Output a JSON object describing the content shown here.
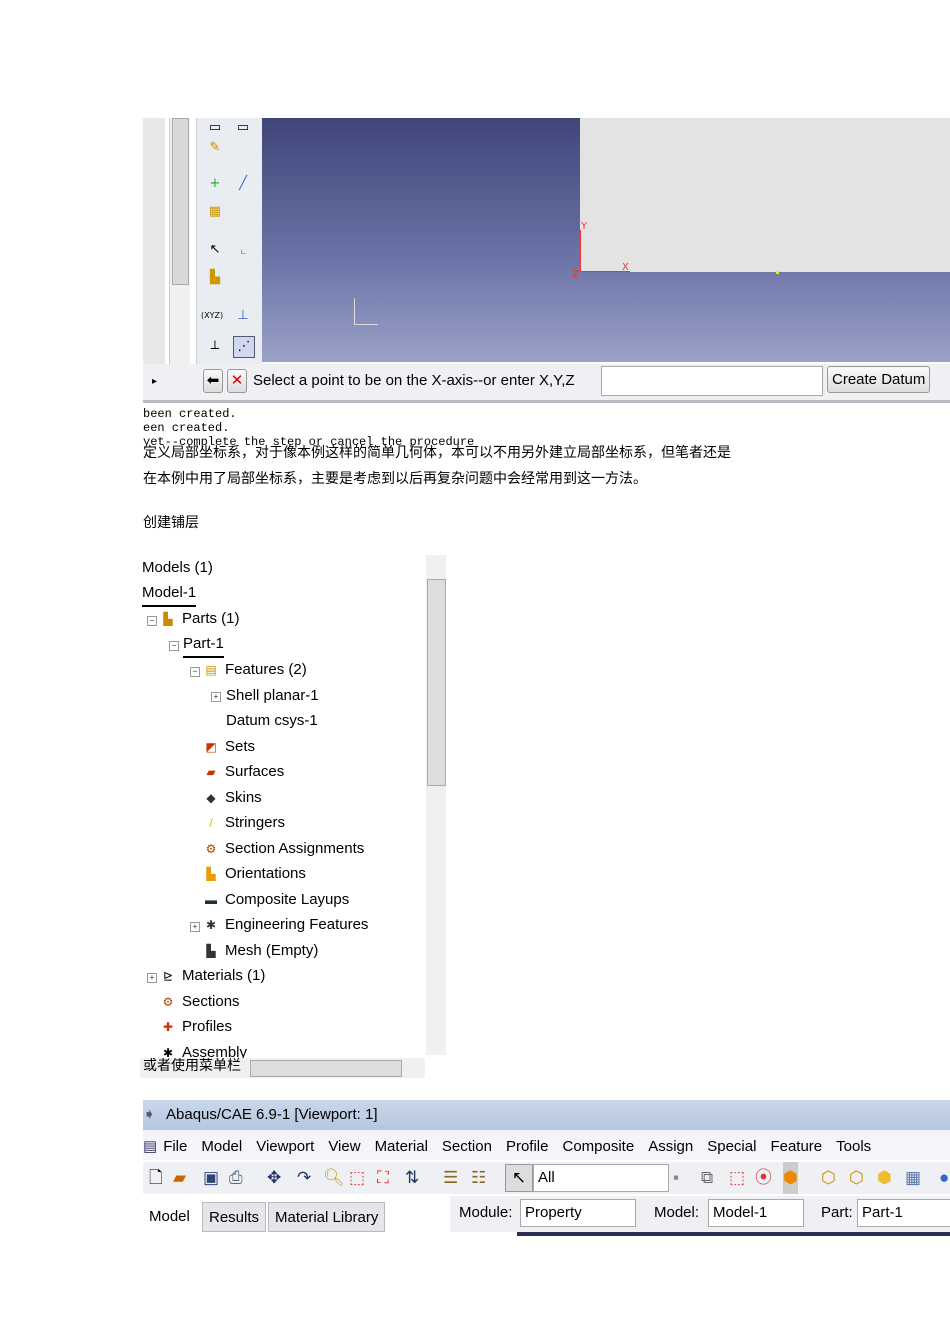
{
  "viewport": {
    "axis_y": "Y",
    "axis_x": "X",
    "axis_z": "Z"
  },
  "prompt": {
    "text": "Select a point to be on the X-axis--or enter X,Y,Z",
    "input_value": "",
    "create_button": "Create Datum"
  },
  "messages": [
    "been created.",
    "een created.",
    "yet--complete the step or cancel the procedure"
  ],
  "paragraph": [
    "定义局部坐标系，对于像本例这样的简单几何体，本可以不用另外建立局部坐标系，但笔者还是",
    "在本例中用了局部坐标系，主要是考虑到以后再复杂问题中会经常用到这一方法。"
  ],
  "heading1": "创建铺层",
  "tree": [
    "Models (1)",
    "Model-1",
    "Parts (1)",
    "Part-1",
    "Features (2)",
    "Shell planar-1",
    "Datum csys-1",
    "Sets",
    "Surfaces",
    "Skins",
    "Stringers",
    "Section Assignments",
    "Orientations",
    "Composite Layups",
    "Engineering Features",
    "Mesh (Empty)",
    "Materials (1)",
    "Sections",
    "Profiles",
    "Assembly"
  ],
  "heading2": "或者使用菜单栏",
  "app": {
    "title": "Abaqus/CAE 6.9-1 [Viewport: 1]",
    "menu": [
      "File",
      "Model",
      "Viewport",
      "View",
      "Material",
      "Section",
      "Profile",
      "Composite",
      "Assign",
      "Special",
      "Feature",
      "Tools"
    ],
    "selection_filter": "All",
    "tabs": [
      "Model",
      "Results",
      "Material Library"
    ],
    "module_label": "Module:",
    "module": "Property",
    "model_label": "Model:",
    "model": "Model-1",
    "part_label": "Part:",
    "part": "Part-1"
  }
}
